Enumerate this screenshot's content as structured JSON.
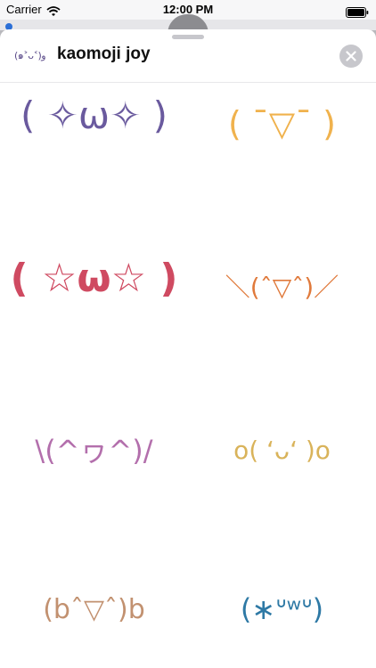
{
  "status_bar": {
    "carrier": "Carrier",
    "time": "12:00 PM",
    "wifi_icon": "wifi-icon",
    "battery_icon": "battery-icon"
  },
  "header": {
    "app_icon_text": "(๑˃ᴗ˂)ﻭ",
    "title": "kaomoji joy",
    "close_icon": "close-icon"
  },
  "stickers": [
    {
      "text": "( ✧ω✧ )",
      "color": "#6a5a9e"
    },
    {
      "text": "( ¯▽¯ )",
      "color": "#f0b24d"
    },
    {
      "text": "( ☆ω☆ )",
      "color": "#cf4a61"
    },
    {
      "text": "＼(ˆ▽ˆ)／",
      "color": "#e07a3c"
    },
    {
      "text": "\\(^ヮ^)/",
      "color": "#b36fac"
    },
    {
      "text": "o( ‘ᴗ‘ )o",
      "color": "#d9b35a"
    },
    {
      "text": "(bˆ▽ˆ)b",
      "color": "#c29170"
    },
    {
      "text": "(∗ᐡʷᐡ)",
      "color": "#2e79a5"
    }
  ]
}
